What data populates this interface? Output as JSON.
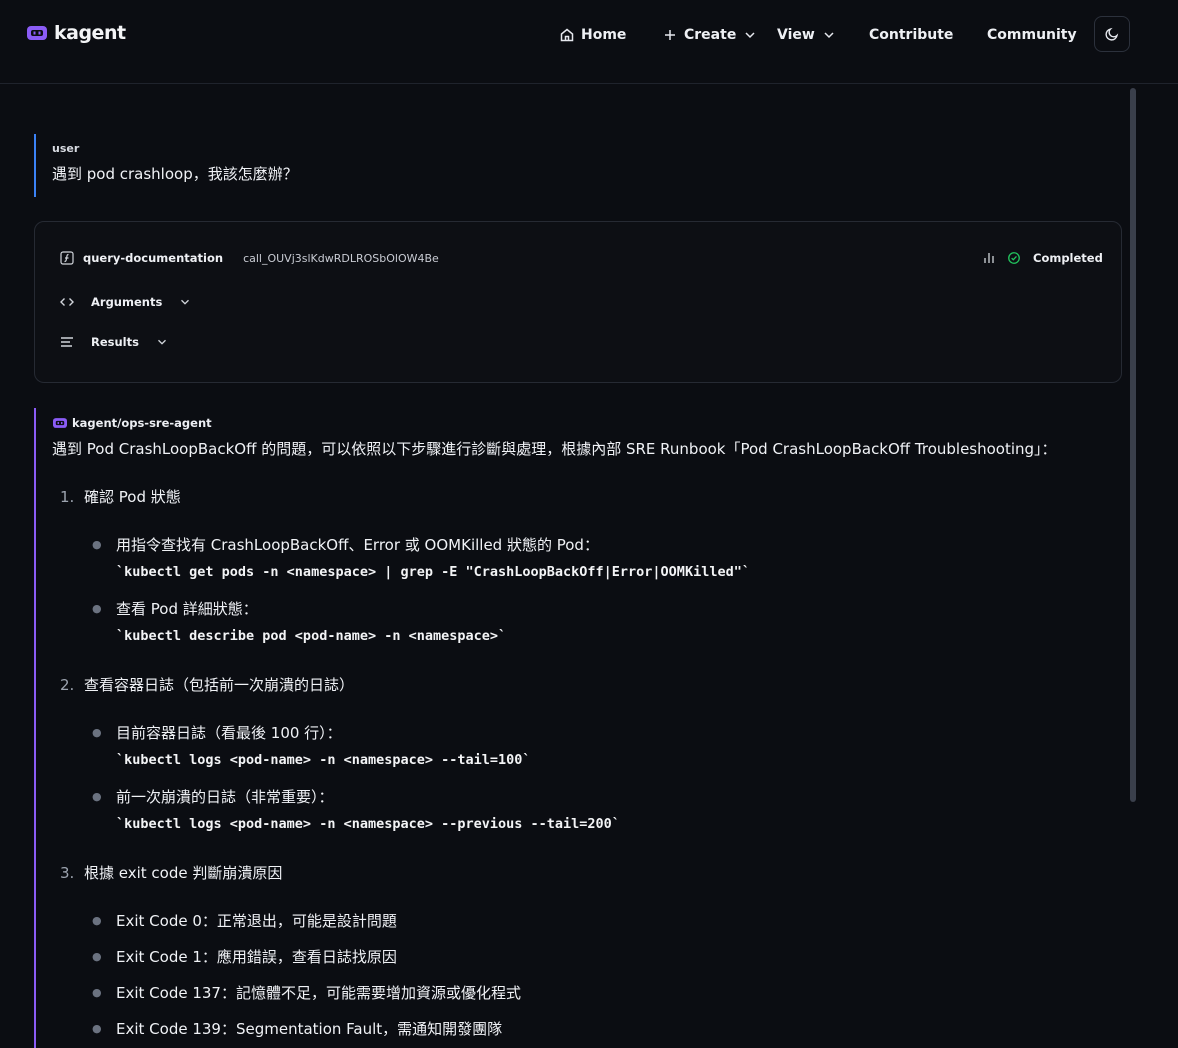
{
  "brand": {
    "name": "kagent",
    "accent": "#8b5cf6"
  },
  "nav": {
    "home": "Home",
    "create": "Create",
    "view": "View",
    "contribute": "Contribute",
    "community": "Community"
  },
  "user_message": {
    "role": "user",
    "text": "遇到 pod crashloop，我該怎麼辦？"
  },
  "tool_call": {
    "name": "query-documentation",
    "call_id": "call_OUVj3slKdwRDLROSbOlOW4Be",
    "status": "Completed",
    "arguments_label": "Arguments",
    "results_label": "Results"
  },
  "agent_message": {
    "agent": "kagent/ops-sre-agent",
    "intro": "遇到 Pod CrashLoopBackOff 的問題，可以依照以下步驟進行診斷與處理，根據內部 SRE Runbook「Pod CrashLoopBackOff Troubleshooting」：",
    "steps": [
      {
        "num": "1.",
        "title": "確認 Pod 狀態",
        "bullets": [
          {
            "text": "用指令查找有 CrashLoopBackOff、Error 或 OOMKilled 狀態的 Pod：",
            "code": "`kubectl get pods -n <namespace> | grep -E \"CrashLoopBackOff|Error|OOMKilled\"`"
          },
          {
            "text": "查看 Pod 詳細狀態：",
            "code": "`kubectl describe pod <pod-name> -n <namespace>`"
          }
        ]
      },
      {
        "num": "2.",
        "title": "查看容器日誌（包括前一次崩潰的日誌）",
        "bullets": [
          {
            "text": "目前容器日誌（看最後 100 行）：",
            "code": "`kubectl logs <pod-name> -n <namespace> --tail=100`"
          },
          {
            "text": "前一次崩潰的日誌（非常重要）：",
            "code": "`kubectl logs <pod-name> -n <namespace> --previous --tail=200`"
          }
        ]
      },
      {
        "num": "3.",
        "title": "根據 exit code 判斷崩潰原因",
        "bullets": [
          {
            "text": "Exit Code 0：正常退出，可能是設計問題"
          },
          {
            "text": "Exit Code 1：應用錯誤，查看日誌找原因"
          },
          {
            "text": "Exit Code 137：記憶體不足，可能需要增加資源或優化程式"
          },
          {
            "text": "Exit Code 139：Segmentation Fault，需通知開發團隊"
          }
        ]
      }
    ]
  }
}
